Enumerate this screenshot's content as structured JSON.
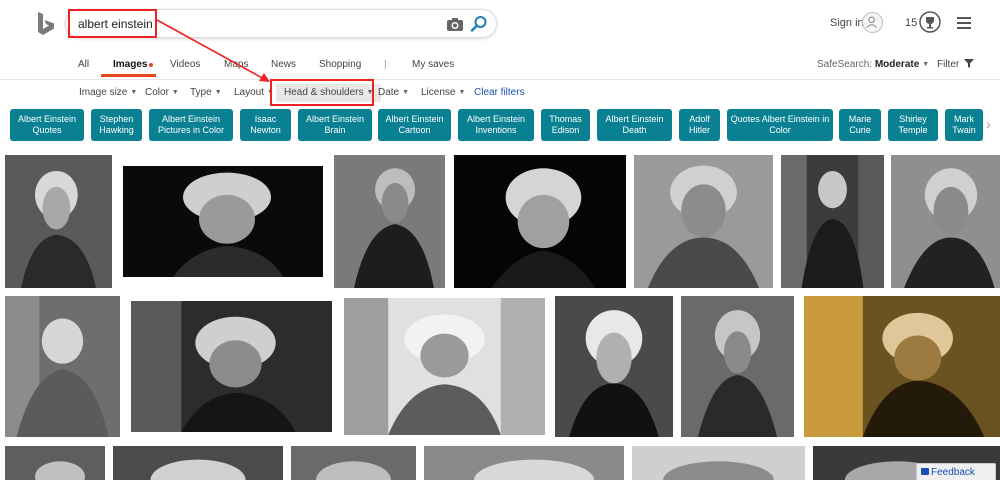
{
  "header": {
    "search_query": "albert einstein",
    "signin_label": "Sign in",
    "rewards_count": "15"
  },
  "tabs": [
    {
      "label": "All"
    },
    {
      "label": "Images"
    },
    {
      "label": "Videos"
    },
    {
      "label": "Maps"
    },
    {
      "label": "News"
    },
    {
      "label": "Shopping"
    },
    {
      "label": "|"
    },
    {
      "label": "My saves"
    }
  ],
  "safesearch": {
    "label": "SafeSearch:",
    "value": "Moderate"
  },
  "filter_label": "Filter",
  "filters": [
    {
      "label": "Image size"
    },
    {
      "label": "Color"
    },
    {
      "label": "Type"
    },
    {
      "label": "Layout"
    },
    {
      "label": "Head & shoulders"
    },
    {
      "label": "Date"
    },
    {
      "label": "License"
    },
    {
      "label": "Clear filters"
    }
  ],
  "chips": [
    "Albert Einstein Quotes",
    "Stephen Hawking",
    "Albert Einstein Pictures in Color",
    "Isaac Newton",
    "Albert Einstein Brain",
    "Albert Einstein Cartoon",
    "Albert Einstein Inventions",
    "Thomas Edison",
    "Albert Einstein Death",
    "Adolf Hitler",
    "Quotes Albert Einstein in Color",
    "Marie Curie",
    "Shirley Temple",
    "Mark Twain"
  ],
  "feedback_label": "Feedback",
  "colors": {
    "accent": "#e2471e",
    "chip": "#0a8193",
    "link": "#1a4fb4",
    "annotation": "#ee2222"
  }
}
